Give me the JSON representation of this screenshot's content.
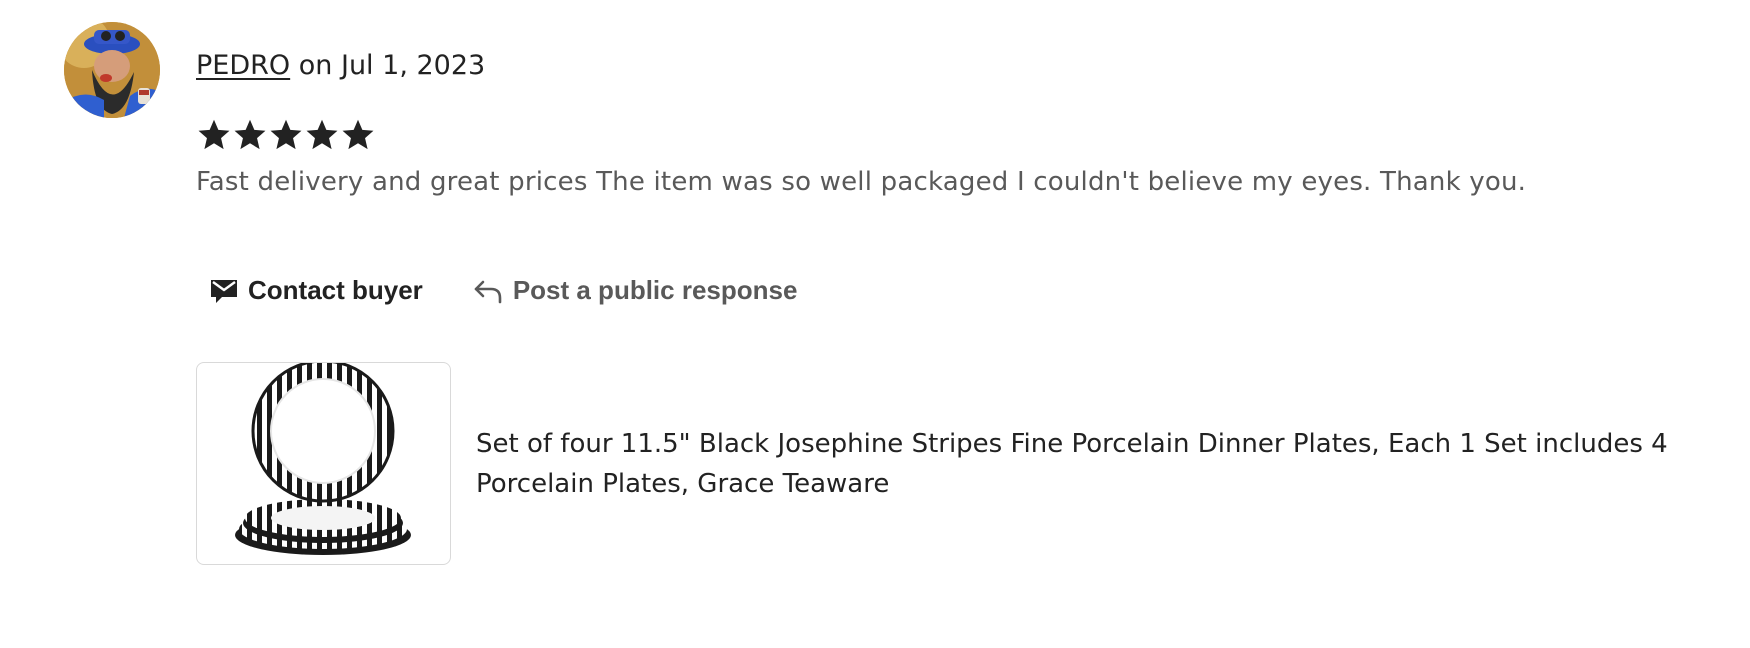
{
  "review": {
    "reviewer_name": "PEDRO",
    "date_prefix": "on",
    "date": "Jul 1, 2023",
    "rating": 5,
    "rating_max": 5,
    "text": "Fast delivery and great prices The item was so well packaged I couldn't believe my eyes. Thank you."
  },
  "actions": {
    "contact_label": "Contact buyer",
    "respond_label": "Post a public response"
  },
  "listing": {
    "title": "Set of four 11.5\" Black Josephine Stripes Fine Porcelain Dinner Plates, Each 1 Set includes 4 Porcelain Plates, Grace Teaware"
  },
  "colors": {
    "text_primary": "#222222",
    "text_secondary": "#595959",
    "star": "#222222",
    "thumb_border": "#d9d9d9"
  },
  "icons": {
    "contact": "envelope-icon",
    "respond": "reply-arrow-icon",
    "star": "star-icon"
  }
}
